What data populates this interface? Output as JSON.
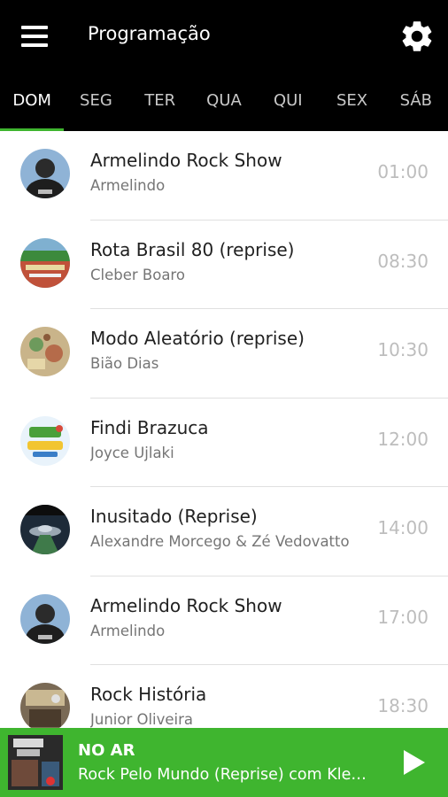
{
  "header": {
    "title": "Programação",
    "menu_icon": "menu-icon",
    "settings_icon": "gear-icon"
  },
  "tabs": [
    {
      "label": "DOM",
      "active": true
    },
    {
      "label": "SEG"
    },
    {
      "label": "TER"
    },
    {
      "label": "QUA"
    },
    {
      "label": "QUI"
    },
    {
      "label": "SEX"
    },
    {
      "label": "SÁB"
    }
  ],
  "schedule": [
    {
      "title": "Armelindo Rock Show",
      "host": "Armelindo",
      "time": "01:00"
    },
    {
      "title": "Rota Brasil 80 (reprise)",
      "host": "Cleber Boaro",
      "time": "08:30"
    },
    {
      "title": "Modo Aleatório (reprise)",
      "host": "Bião Dias",
      "time": "10:30"
    },
    {
      "title": "Findi Brazuca",
      "host": "Joyce Ujlaki",
      "time": "12:00"
    },
    {
      "title": "Inusitado (Reprise)",
      "host": "Alexandre Morcego & Zé Vedovatto",
      "time": "14:00"
    },
    {
      "title": "Armelindo Rock Show",
      "host": "Armelindo",
      "time": "17:00"
    },
    {
      "title": "Rock História",
      "host": "Junior Oliveira",
      "time": "18:30"
    }
  ],
  "player": {
    "label": "NO AR",
    "now_playing": "Rock Pelo Mundo (Reprise) com Kleber Cunha",
    "play_icon": "play-icon"
  },
  "colors": {
    "accent": "#3fb52f",
    "appbar": "#000000"
  }
}
